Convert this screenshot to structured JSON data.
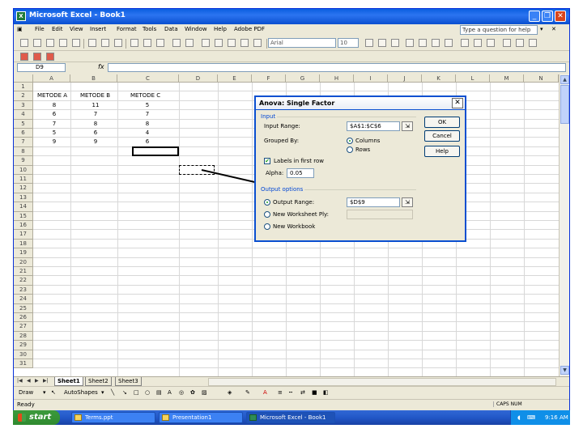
{
  "window": {
    "title": "Microsoft Excel - Book1"
  },
  "menu": {
    "items": [
      "File",
      "Edit",
      "View",
      "Insert",
      "Format",
      "Tools",
      "Data",
      "Window",
      "Help",
      "Adobe PDF"
    ],
    "ask_placeholder": "Type a question for help"
  },
  "toolbar": {
    "font": "Arial",
    "size": "10"
  },
  "formula_bar": {
    "name_box": "D9",
    "fx": "fx",
    "content": ""
  },
  "grid": {
    "columns": [
      "A",
      "B",
      "C",
      "D",
      "E",
      "F",
      "G",
      "H",
      "I",
      "J",
      "K",
      "L",
      "M",
      "N"
    ],
    "rows": [
      "1",
      "2",
      "3",
      "4",
      "5",
      "6",
      "7",
      "8",
      "9",
      "10",
      "11",
      "12",
      "13",
      "14",
      "15",
      "16",
      "17",
      "18",
      "19",
      "20",
      "21",
      "22",
      "23",
      "24",
      "25",
      "26",
      "27",
      "28",
      "29",
      "30",
      "31"
    ],
    "headers": [
      "METODE A",
      "METODE B",
      "METODE C"
    ],
    "data": [
      [
        "8",
        "11",
        "5"
      ],
      [
        "6",
        "7",
        "7"
      ],
      [
        "7",
        "8",
        "8"
      ],
      [
        "5",
        "6",
        "4"
      ],
      [
        "9",
        "9",
        "6"
      ]
    ]
  },
  "sheets": [
    "Sheet1",
    "Sheet2",
    "Sheet3"
  ],
  "drawing": {
    "draw_label": "Draw",
    "autoshapes_label": "AutoShapes"
  },
  "status": {
    "left": "Ready",
    "right": "CAPS NUM"
  },
  "dialog": {
    "title": "Anova: Single Factor",
    "input_group": "Input",
    "input_range_label": "Input Range:",
    "input_range_value": "$A$1:$C$6",
    "grouped_by_label": "Grouped By:",
    "columns_label": "Columns",
    "rows_label": "Rows",
    "labels_label": "Labels in first row",
    "alpha_label": "Alpha:",
    "alpha_value": "0.05",
    "output_group": "Output options",
    "output_range_label": "Output Range:",
    "output_range_value": "$D$9",
    "new_worksheet_label": "New Worksheet Ply:",
    "new_workbook_label": "New Workbook",
    "ok": "OK",
    "cancel": "Cancel",
    "help": "Help"
  },
  "taskbar": {
    "start": "start",
    "items": [
      "Terms.ppt",
      "Presentation1",
      "Microsoft Excel - Book1"
    ],
    "clock": "9:16 AM"
  }
}
